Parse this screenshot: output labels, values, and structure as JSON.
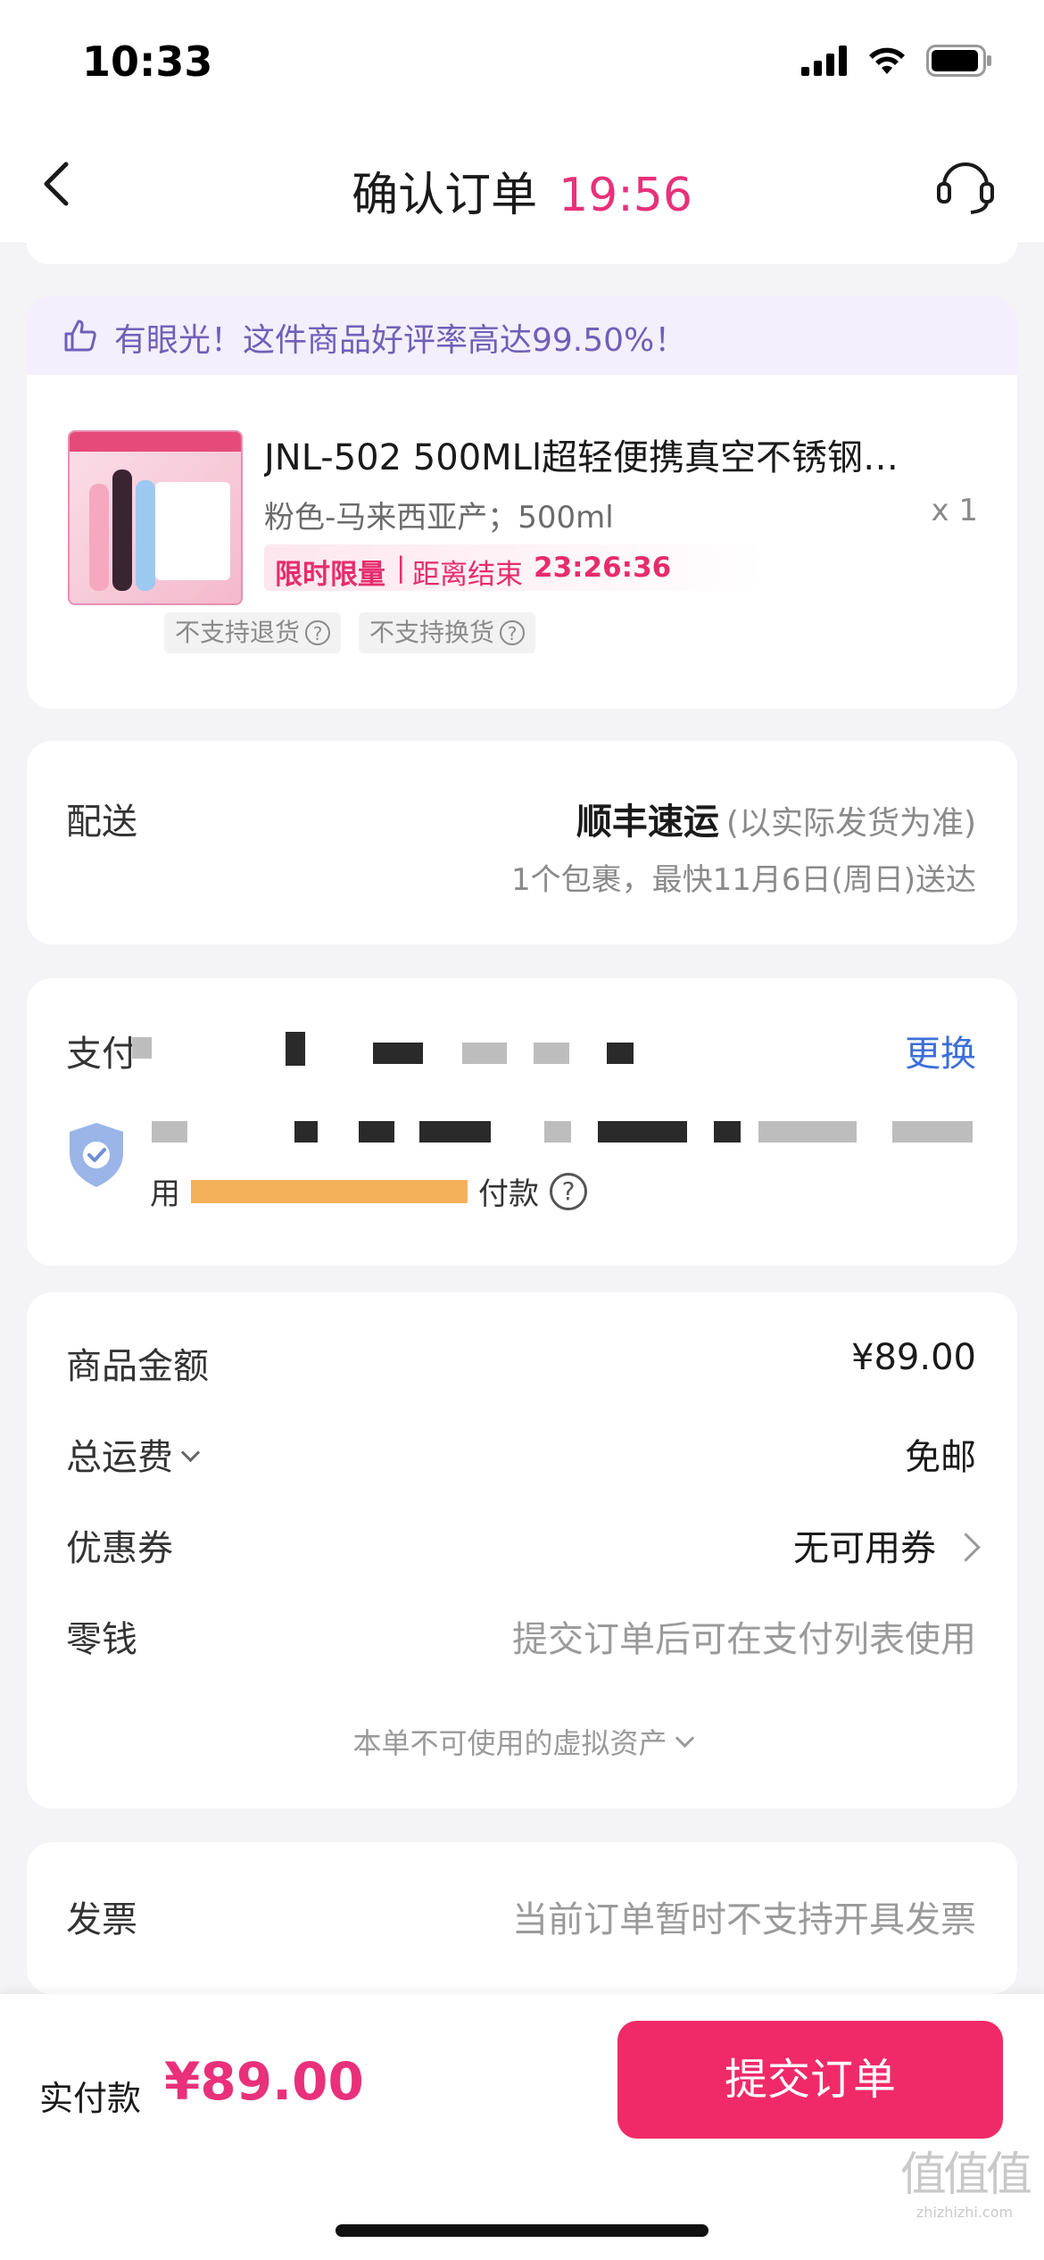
{
  "status": {
    "time": "10:33"
  },
  "nav": {
    "title": "确认订单",
    "countdown": "19:56"
  },
  "praise": {
    "text": "有眼光！这件商品好评率高达99.50%！"
  },
  "product": {
    "title": "JNL-502 500MLl超轻便携真空不锈钢…",
    "spec": "粉色-马来西亚产；500ml",
    "qty": "x 1",
    "promo_tag": "限时限量",
    "promo_sep": "|",
    "promo_end_label": "距离结束",
    "promo_timer": "23:26:36",
    "chips": [
      "不支持退货",
      "不支持换货"
    ]
  },
  "delivery": {
    "label": "配送",
    "carrier": "顺丰速运",
    "carrier_note": "(以实际发货为准)",
    "eta": "1个包裹，最快11月6日(周日)送达"
  },
  "payment": {
    "label": "支付",
    "change_label": "更换",
    "line2_prefix": "用",
    "line2_suffix": "付款"
  },
  "prices": {
    "goods_label": "商品金额",
    "goods_value": "¥89.00",
    "shipping_label": "总运费",
    "shipping_value": "免邮",
    "coupon_label": "优惠券",
    "coupon_value": "无可用券",
    "change_label": "零钱",
    "change_value": "提交订单后可在支付列表使用",
    "virtual_assets": "本单不可使用的虚拟资产"
  },
  "invoice": {
    "label": "发票",
    "value": "当前订单暂时不支持开具发票"
  },
  "bottom": {
    "pay_label": "实付款",
    "pay_amount": "¥89.00",
    "submit_label": "提交订单"
  },
  "watermark": {
    "glyph": "值值值",
    "url": "zhizhizhi.com"
  },
  "colors": {
    "accent": "#e8317a",
    "button": "#f02a68",
    "link": "#3b6fd8",
    "praise_text": "#6f60b8"
  }
}
